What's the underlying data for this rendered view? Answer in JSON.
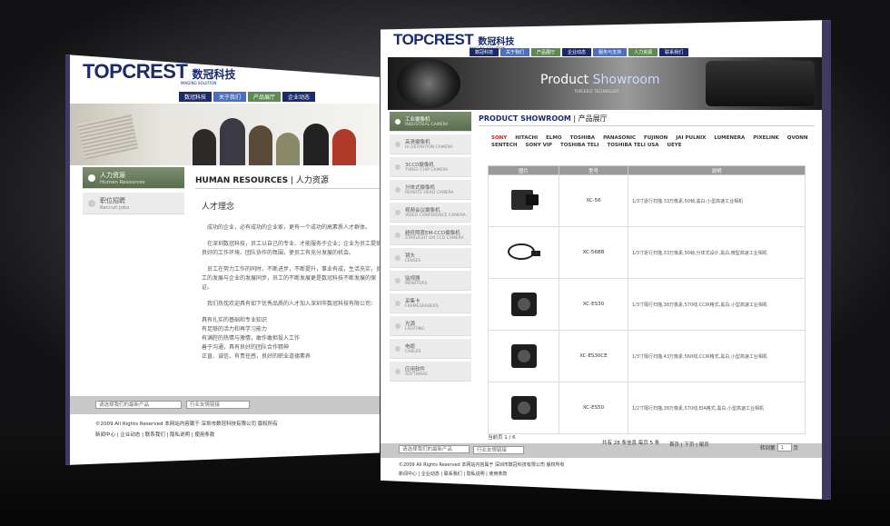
{
  "left_page": {
    "logo": {
      "name": "TOPCREST",
      "cn": "数冠科技",
      "sub": "IMAGING SOLUTION"
    },
    "nav": [
      "数冠科技",
      "关于我们",
      "产品展厅",
      "企业动态"
    ],
    "sidebar": [
      {
        "cn": "人力资源",
        "en": "Human Resources"
      },
      {
        "cn": "职位招聘",
        "en": "Recruit jobs"
      }
    ],
    "section_title_en": "HUMAN RESOURCES",
    "section_title_cn": "人力资源",
    "subheading": "人才理念",
    "paragraphs": [
      "成功的企业，必有成功的企业家，更有一个成功的高素质人才群体。",
      "在深圳数冠科技，员工以自己的专业、才能服务于企业；企业为员工提供良好的工作环境、团队协作的氛围，使员工有充分发展的机会。",
      "员工在努力工作的同时，不断进步，不断提升，事业有成，生活充实，员工的发展与企业的发展同步，员工的不断发展更是数冠科技不断发展的保证。",
      "我们热忱欢迎具有如下优秀品质的人才加入深圳市数冠科技有限公司："
    ],
    "qualities": [
      "具有扎实的基础和专业知识",
      "有足够的活力和再学习能力",
      "有满腔的热情与激情，敢作敢担投入工作",
      "善于沟通，具有良好的团队合作精神",
      "正直、诚信、有责任感，良好的职业道德素养"
    ],
    "select1": "请选择我们的最新产品",
    "select2": "行业友情链接",
    "copyright": "©2009 All Rights Reserved 本网站内容属于 深圳市数冠科技有限公司 版权所有",
    "footer_links": "新闻中心 | 企业动态 | 联系我们 | 隐私说明 | 使用条款"
  },
  "right_page": {
    "logo": {
      "name": "TOPCREST",
      "cn": "数冠科技",
      "sub": "IMAGING SOLUTION"
    },
    "nav": [
      "数冠科技",
      "关于我们",
      "产品展厅",
      "企业动态",
      "服务与支持",
      "人力资源",
      "联系我们"
    ],
    "banner_title_1": "Product ",
    "banner_title_2": "Showroom",
    "banner_sub": "TOPCREST TECHNOLOGY",
    "sidebar": [
      {
        "cn": "工业摄像机",
        "en": "INDUSTRIAL CAMERA"
      },
      {
        "cn": "高清摄像机",
        "en": "HI DEFINITION CAMERA"
      },
      {
        "cn": "3CCD摄像机",
        "en": "THREE CHIP CAMERA"
      },
      {
        "cn": "分体式摄像机",
        "en": "REMOTE HEAD CAMERA"
      },
      {
        "cn": "视频会议摄像机",
        "en": "VIDEO CONFERENCE CAMERA"
      },
      {
        "cn": "超低照度EM-CCD摄像机",
        "en": "STARLIGHT EM CCD CAMERA"
      },
      {
        "cn": "镜头",
        "en": "LENSES"
      },
      {
        "cn": "监视器",
        "en": "MONITORS"
      },
      {
        "cn": "采集卡",
        "en": "FRAMEGRABERS"
      },
      {
        "cn": "光源",
        "en": "LIGHTING"
      },
      {
        "cn": "电缆",
        "en": "CABLES"
      },
      {
        "cn": "应用软件",
        "en": "SOFTWARE"
      }
    ],
    "section_title_en": "PRODUCT SHOWROOM",
    "section_title_cn": "产品展厅",
    "brands": [
      "SONY",
      "HITACHI",
      "ELMO",
      "TOSHIBA",
      "PANASONIC",
      "FUJINON",
      "JAI PULNIX",
      "LUMENERA",
      "PIXELINK",
      "QVONN",
      "SENTECH",
      "SONY VIP",
      "TOSHIBA TELI",
      "TOSHIBA TELI USA",
      "UEYE"
    ],
    "table_headers": [
      "图片",
      "型号",
      "说明"
    ],
    "products": [
      {
        "model": "XC-56",
        "desc": "1/3寸逐行扫描,33万像素,50帧,黑白,小型高速工业相机"
      },
      {
        "model": "XC-56BB",
        "desc": "1/3寸逐行扫描,33万像素,50帧,分体式设计,黑白,微型高速工业相机"
      },
      {
        "model": "XC-ES30",
        "desc": "1/3寸隔行扫描,38万像素,570线,CCIR格式,黑白,小型高速工业相机"
      },
      {
        "model": "XC-ES30CE",
        "desc": "1/3寸隔行扫描,43万像素,560线,CCIR格式,黑白,小型高速工业相机"
      },
      {
        "model": "XC-ES50",
        "desc": "1/2寸隔行扫描,38万像素,570线,EIA格式,黑白,小型高速工业相机"
      }
    ],
    "pager_current": "当前页 1 / 6",
    "pager_info": "共有 28 条信息  每页 5 条",
    "pager_links": "首页 | 下页 | 尾页",
    "goto_label": "转到第",
    "goto_value": "1",
    "goto_unit": "页",
    "select1": "请选择我们的最新产品",
    "select2": "行业友情链接",
    "copyright": "©2009 All Rights Reserved 本网站内容属于 深圳市数冠科技有限公司 版权所有",
    "footer_links": "新闻中心 | 企业动态 | 联系我们 | 隐私说明 | 使用条款"
  }
}
